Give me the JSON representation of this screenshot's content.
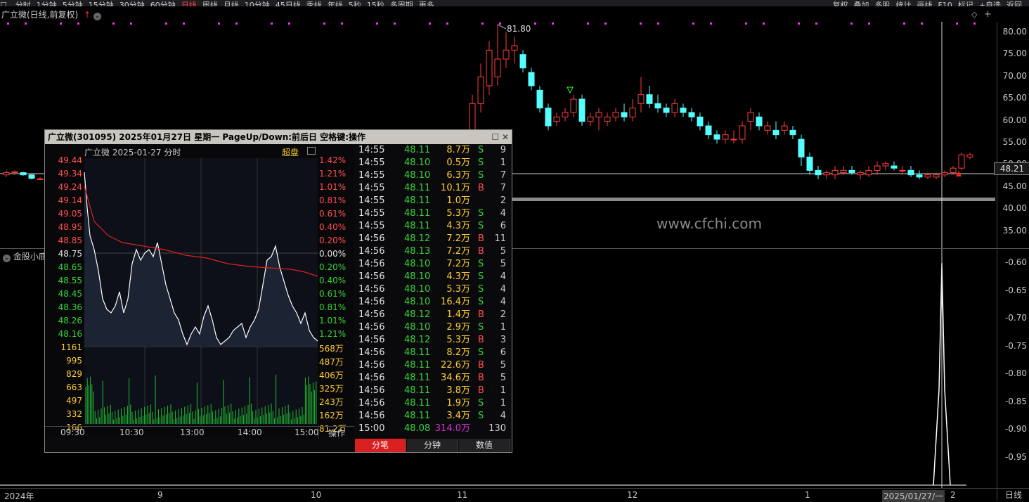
{
  "toolbar": {
    "items": [
      "分时",
      "1分钟",
      "5分钟",
      "15分钟",
      "30分钟",
      "60分钟",
      "日线",
      "周线",
      "月线",
      "10分钟",
      "45日线",
      "季线",
      "年线",
      "5秒",
      "15秒",
      "多周期",
      "更多"
    ],
    "active_index": 6,
    "right_items": [
      "复权",
      "叠加",
      "多股",
      "统计",
      "画线",
      "F10",
      "标记",
      "+自选",
      "返回"
    ]
  },
  "title": "广立微(日线,前复权)",
  "main_chart": {
    "y_ticks": [
      "80.00",
      "75.00",
      "70.00",
      "65.00",
      "60.00",
      "55.00",
      "50.00",
      "45.00",
      "40.00",
      "35.00"
    ],
    "current_price": "48.21",
    "high_label": "81.80"
  },
  "indicator": {
    "title": "金股小底",
    "y_ticks": [
      "-0.60",
      "-0.65",
      "-0.70",
      "-0.75",
      "-0.80",
      "-0.85",
      "-0.90",
      "-0.95"
    ]
  },
  "date_axis": {
    "labels": [
      "2024年",
      "9",
      "10",
      "11",
      "12",
      "1",
      "2"
    ],
    "current_date": "2025/01/27/一",
    "period_label": "日线"
  },
  "watermark": "www.cfchi.com",
  "popup": {
    "title": "广立微(301095)  2025年01月27日 星期一  PageUp/Down:前后日  空格键:操作",
    "header_name": "广立微  2025-01-27  分时",
    "header_tag": "超盘",
    "left_prices": [
      "49.44",
      "49.34",
      "49.24",
      "49.14",
      "49.05",
      "48.95",
      "48.85",
      "48.75",
      "48.65",
      "48.55",
      "48.45",
      "48.36",
      "48.26",
      "48.16"
    ],
    "right_pcts": [
      "1.42%",
      "1.21%",
      "1.01%",
      "0.81%",
      "0.61%",
      "0.40%",
      "0.20%",
      "0.00%",
      "0.20%",
      "0.40%",
      "0.61%",
      "0.81%",
      "1.01%",
      "1.21%"
    ],
    "left_vols": [
      "1161",
      "995",
      "829",
      "663",
      "497",
      "332",
      "166"
    ],
    "right_vols": [
      "568万",
      "487万",
      "406万",
      "325万",
      "243万",
      "162万",
      "81.2万"
    ],
    "time_labels": [
      "09:30",
      "10:30",
      "13:00",
      "14:00",
      "15:00"
    ],
    "op_label": "操作",
    "ticks": [
      {
        "time": "14:55",
        "price": "48.11",
        "vol": "8.7万",
        "bs": "S",
        "cnt": "9"
      },
      {
        "time": "14:55",
        "price": "48.10",
        "vol": "0.5万",
        "bs": "S",
        "cnt": "1"
      },
      {
        "time": "14:55",
        "price": "48.10",
        "vol": "6.3万",
        "bs": "S",
        "cnt": "7"
      },
      {
        "time": "14:55",
        "price": "48.11",
        "vol": "10.1万",
        "bs": "B",
        "cnt": "7"
      },
      {
        "time": "14:55",
        "price": "48.11",
        "vol": "1.0万",
        "bs": "",
        "cnt": "2"
      },
      {
        "time": "14:55",
        "price": "48.11",
        "vol": "5.3万",
        "bs": "S",
        "cnt": "4"
      },
      {
        "time": "14:55",
        "price": "48.11",
        "vol": "4.3万",
        "bs": "S",
        "cnt": "6"
      },
      {
        "time": "14:56",
        "price": "48.12",
        "vol": "7.2万",
        "bs": "B",
        "cnt": "11"
      },
      {
        "time": "14:56",
        "price": "48.13",
        "vol": "7.2万",
        "bs": "B",
        "cnt": "5"
      },
      {
        "time": "14:56",
        "price": "48.10",
        "vol": "7.2万",
        "bs": "S",
        "cnt": "5"
      },
      {
        "time": "14:56",
        "price": "48.10",
        "vol": "4.3万",
        "bs": "S",
        "cnt": "4"
      },
      {
        "time": "14:56",
        "price": "48.10",
        "vol": "5.3万",
        "bs": "S",
        "cnt": "4"
      },
      {
        "time": "14:56",
        "price": "48.10",
        "vol": "16.4万",
        "bs": "S",
        "cnt": "4"
      },
      {
        "time": "14:56",
        "price": "48.12",
        "vol": "1.4万",
        "bs": "B",
        "cnt": "2"
      },
      {
        "time": "14:56",
        "price": "48.10",
        "vol": "2.9万",
        "bs": "S",
        "cnt": "1"
      },
      {
        "time": "14:56",
        "price": "48.12",
        "vol": "5.3万",
        "bs": "B",
        "cnt": "3"
      },
      {
        "time": "14:56",
        "price": "48.11",
        "vol": "8.2万",
        "bs": "S",
        "cnt": "6"
      },
      {
        "time": "14:56",
        "price": "48.11",
        "vol": "22.6万",
        "bs": "B",
        "cnt": "5"
      },
      {
        "time": "14:56",
        "price": "48.11",
        "vol": "34.6万",
        "bs": "B",
        "cnt": "5"
      },
      {
        "time": "14:56",
        "price": "48.11",
        "vol": "3.8万",
        "bs": "B",
        "cnt": "1"
      },
      {
        "time": "14:56",
        "price": "48.11",
        "vol": "1.9万",
        "bs": "S",
        "cnt": "1"
      },
      {
        "time": "14:56",
        "price": "48.11",
        "vol": "3.4万",
        "bs": "S",
        "cnt": "4"
      },
      {
        "time": "15:00",
        "price": "48.08",
        "vol": "314.0万",
        "bs": "",
        "cnt": "130"
      }
    ],
    "tabs": [
      "分笔",
      "分钟",
      "数值"
    ],
    "selected_tab": 0
  }
}
